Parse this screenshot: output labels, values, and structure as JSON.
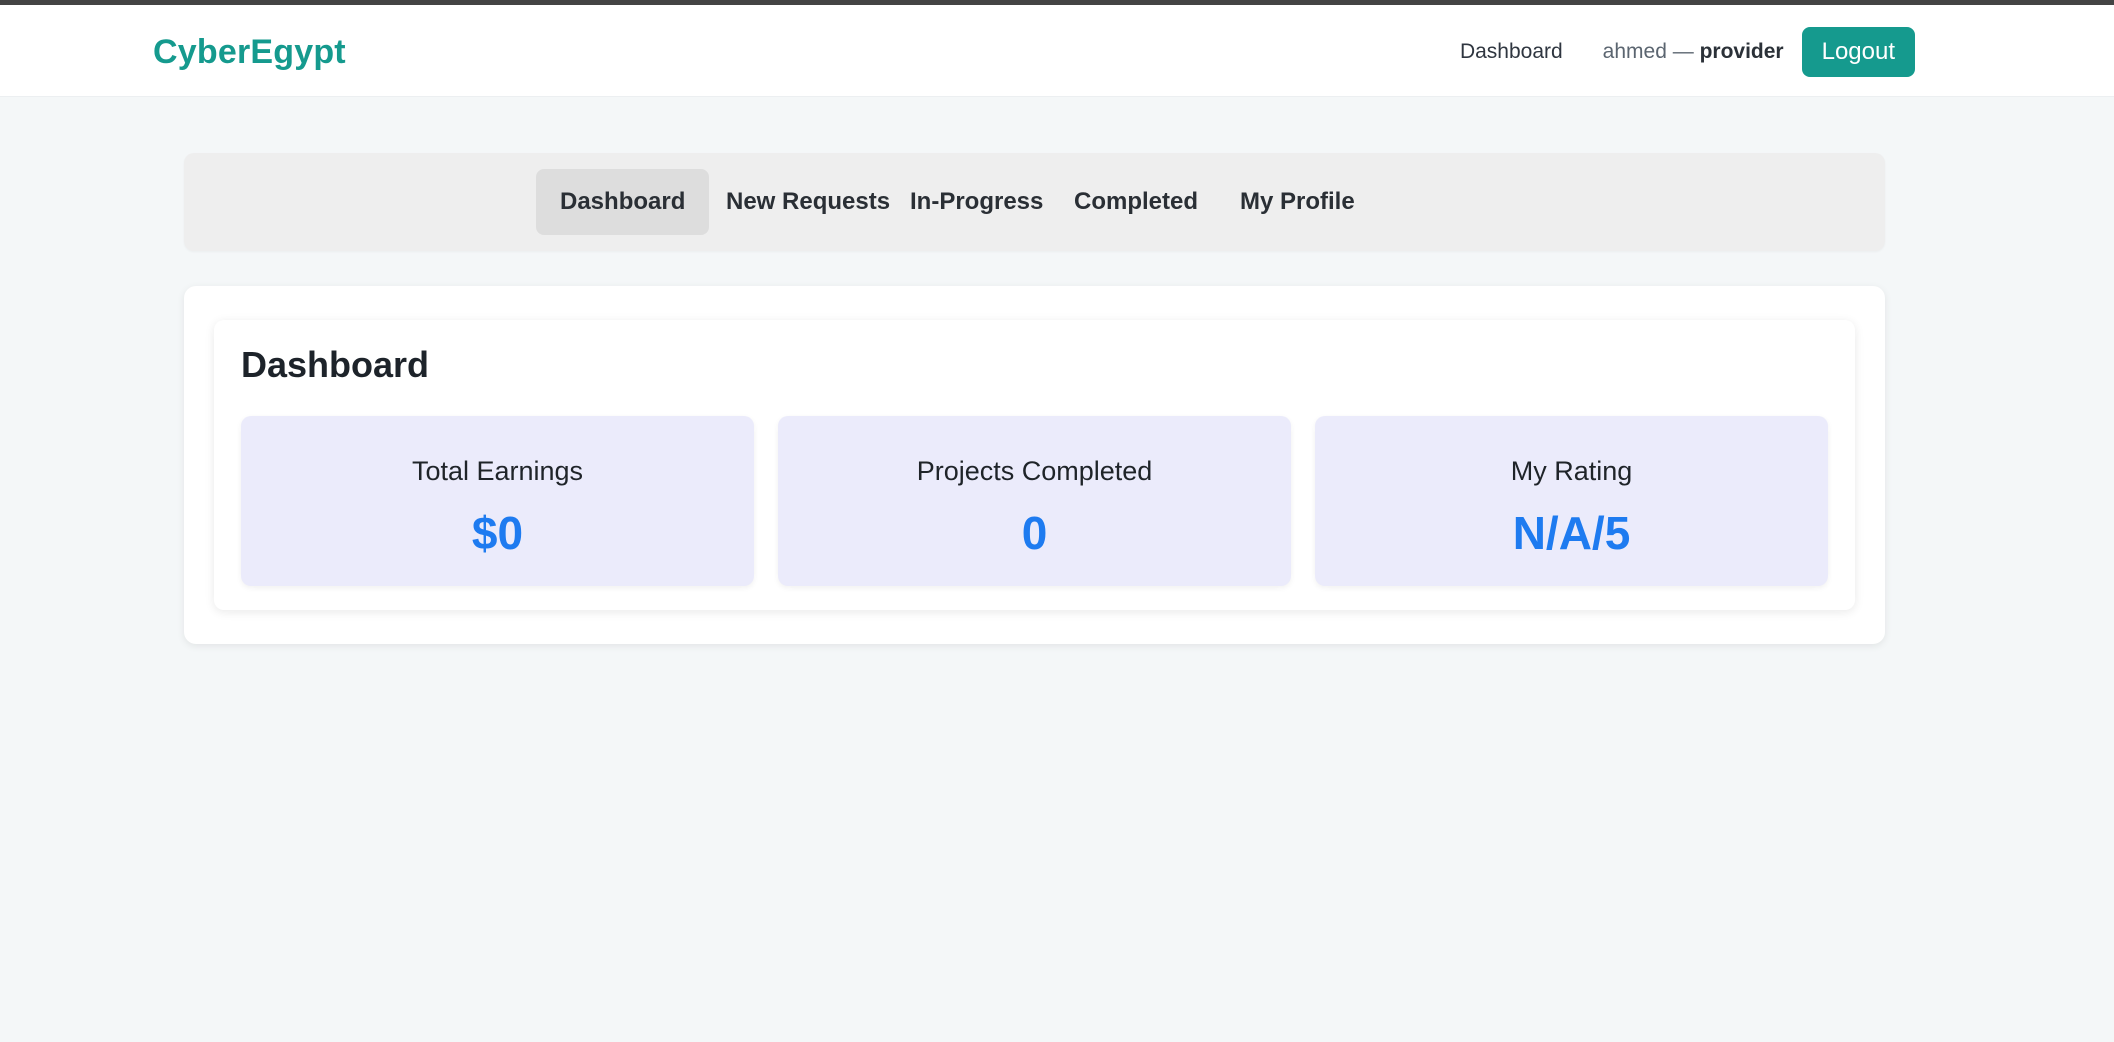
{
  "header": {
    "brand": "CyberEgypt",
    "nav_dashboard": "Dashboard",
    "user_name": "ahmed —",
    "user_role": "provider",
    "logout_label": "Logout"
  },
  "tabs": [
    {
      "label": "Dashboard",
      "active": true
    },
    {
      "label": "New Requests",
      "active": false
    },
    {
      "label": "In-Progress",
      "active": false
    },
    {
      "label": "Completed",
      "active": false
    },
    {
      "label": "My Profile",
      "active": false
    }
  ],
  "dashboard": {
    "title": "Dashboard",
    "stats": [
      {
        "label": "Total Earnings",
        "value": "$0"
      },
      {
        "label": "Projects Completed",
        "value": "0"
      },
      {
        "label": "My Rating",
        "value": "N/A/5"
      }
    ]
  },
  "colors": {
    "brand": "#159a8e",
    "accent_value": "#1e7bf0",
    "page_bg": "#f4f7f8",
    "stat_bg": "#ebebfb"
  }
}
